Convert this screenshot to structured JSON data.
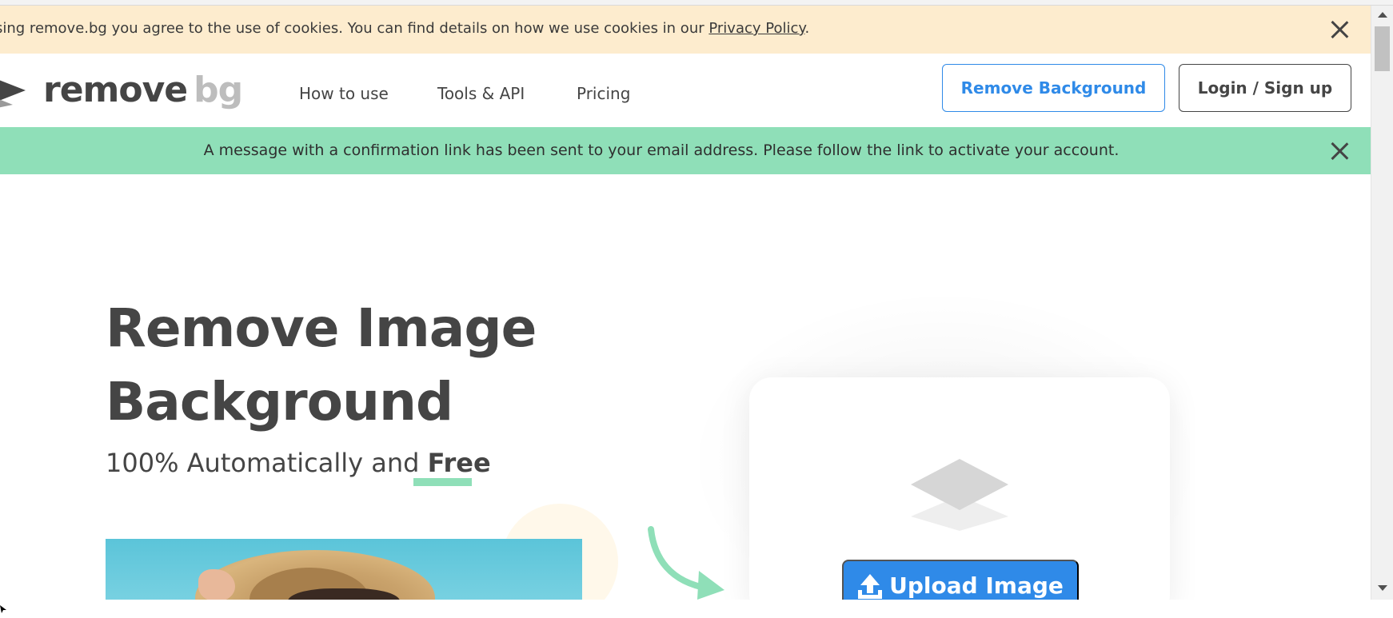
{
  "cookie_banner": {
    "text": "sing remove.bg you agree to the use of cookies. You can find details on how we use cookies in our ",
    "link": "Privacy Policy",
    "after_link": "."
  },
  "header": {
    "logo": {
      "word1": "remove",
      "word2": "bg"
    },
    "nav": [
      {
        "label": "How to use"
      },
      {
        "label": "Tools & API"
      },
      {
        "label": "Pricing"
      }
    ],
    "remove_background_label": "Remove Background",
    "login_label": "Login / Sign up"
  },
  "confirmation": {
    "text": "A message with a confirmation link has been sent to your email address. Please follow the link to activate your account."
  },
  "hero": {
    "title_line1": "Remove Image",
    "title_line2": "Background",
    "subtitle_prefix": "100% Automatically and ",
    "subtitle_bold": "Free"
  },
  "upload": {
    "button_label": "Upload Image"
  },
  "icons": {
    "cookie_close": "close-icon",
    "confirm_close": "close-icon",
    "upload": "upload-icon",
    "layers": "layers-icon",
    "arrow": "curved-arrow-icon"
  },
  "colors": {
    "accent_blue": "#2f8ae8",
    "cookie_bg": "#fdecce",
    "success_green": "#8fdfb8",
    "text_dark": "#454545"
  }
}
